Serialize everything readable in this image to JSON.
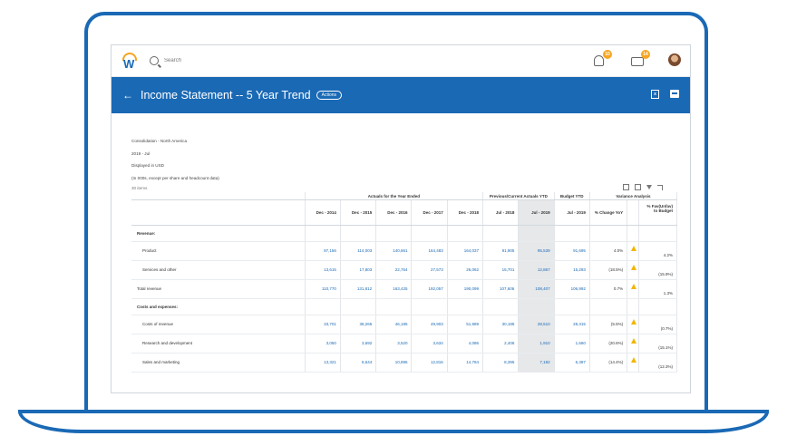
{
  "app": {
    "search_placeholder": "Search",
    "notifications_count": "10",
    "inbox_count": "14"
  },
  "header": {
    "title": "Income Statement -- 5 Year Trend",
    "actions_label": "Actions"
  },
  "report": {
    "meta": [
      "Consolidation - North America",
      "2019 - Jul",
      "Displayed in USD",
      "(In 000s, except per share and headcount data)"
    ],
    "items_count": "30 items"
  },
  "table": {
    "group_headers": {
      "actuals": "Actuals for the Year Ended",
      "ytd": "Previous/Current Actuals YTD",
      "budget": "Budget YTD",
      "variance": "Variance Analysis"
    },
    "columns": [
      "Dec - 2014",
      "Dec - 2015",
      "Dec - 2016",
      "Dec - 2017",
      "Dec - 2018",
      "Jul - 2018",
      "Jul - 2019",
      "Jul - 2019",
      "% Change YoY",
      "",
      "% Fav(Unfav) to Budget"
    ],
    "rows": [
      {
        "label": "Revenue:",
        "type": "section",
        "values": []
      },
      {
        "label": "Product",
        "type": "item",
        "values": [
          "97,156",
          "114,003",
          "140,661",
          "164,483",
          "164,037",
          "91,905",
          "95,539",
          "91,695"
        ],
        "yoy": "4.0%",
        "warn": true,
        "fav": "4.2%"
      },
      {
        "label": "Services and other",
        "type": "item",
        "values": [
          "13,615",
          "17,803",
          "22,764",
          "27,573",
          "26,062",
          "15,701",
          "12,867",
          "15,293"
        ],
        "yoy": "(18.5%)",
        "warn": true,
        "fav": "(15.9%)"
      },
      {
        "label": "Total revenue",
        "type": "total",
        "values": [
          "110,770",
          "131,812",
          "163,425",
          "192,057",
          "190,099",
          "107,606",
          "108,407",
          "106,992"
        ],
        "yoy": "0.7%",
        "warn": true,
        "fav": "1.3%"
      },
      {
        "label": "Costs and expenses:",
        "type": "section",
        "values": []
      },
      {
        "label": "Costs of revenue",
        "type": "item",
        "values": [
          "33,701",
          "38,265",
          "46,185",
          "49,903",
          "51,989",
          "30,185",
          "28,510",
          "28,315"
        ],
        "yoy": "(5.5%)",
        "warn": true,
        "fav": "(0.7%)"
      },
      {
        "label": "Research and development",
        "type": "item",
        "values": [
          "3,050",
          "3,692",
          "3,520",
          "3,634",
          "4,086",
          "2,406",
          "1,910",
          "1,660"
        ],
        "yoy": "(20.6%)",
        "warn": true,
        "fav": "(15.1%)"
      },
      {
        "label": "Sales and marketing",
        "type": "item",
        "values": [
          "13,321",
          "8,644",
          "10,896",
          "12,816",
          "14,784",
          "8,395",
          "7,182",
          "6,397"
        ],
        "yoy": "(14.4%)",
        "warn": true,
        "fav": "(12.3%)"
      }
    ]
  }
}
